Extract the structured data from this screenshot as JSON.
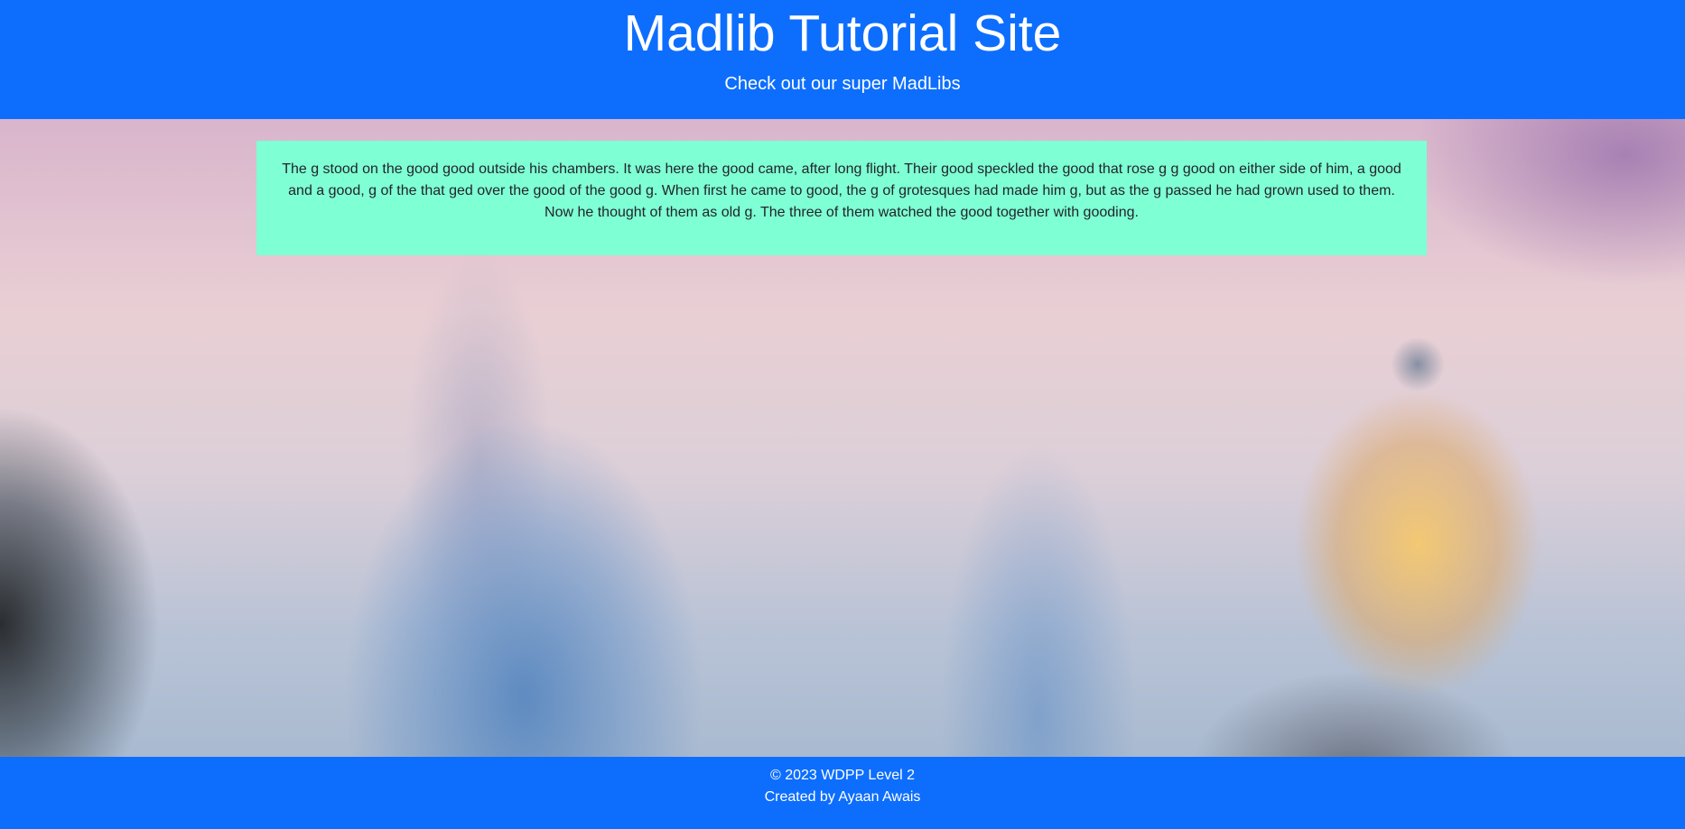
{
  "header": {
    "title": "Madlib Tutorial Site",
    "subtitle": "Check out our super MadLibs",
    "background_color": "#0d6efd"
  },
  "madlib": {
    "story": "The g stood on the good good outside his chambers. It was here the good came, after long flight. Their good speckled the good that rose g g good on either side of him, a good and a good, g of the that ged over the good of the good g. When first he came to good, the g of grotesques had made him g, but as the g passed he had grown used to them. Now he thought of them as old g. The three of them watched the good together with gooding.",
    "background_color": "#7fffd4"
  },
  "footer": {
    "copyright": "© 2023 WDPP Level 2",
    "credit": "Created by Ayaan Awais",
    "background_color": "#0d6efd"
  }
}
